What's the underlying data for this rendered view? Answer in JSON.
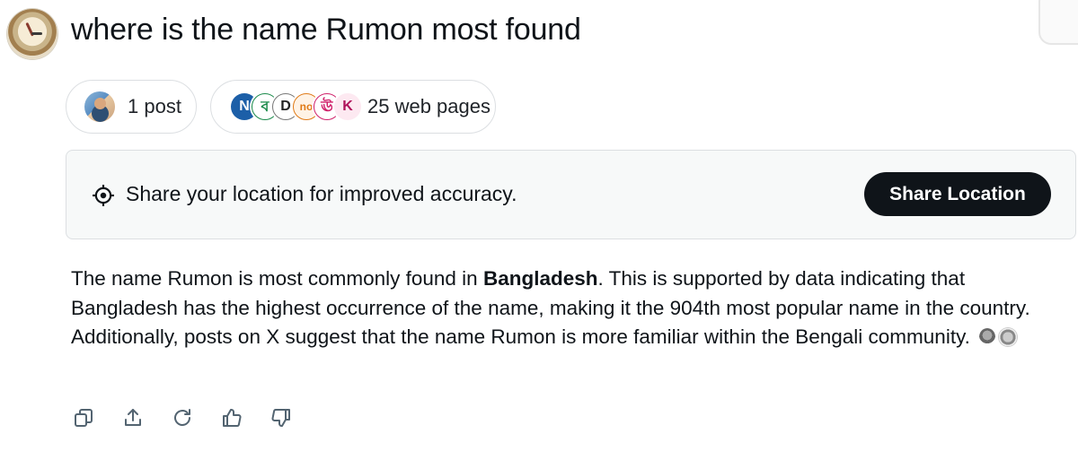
{
  "query": {
    "title": "where is the name Rumon most found"
  },
  "sources": {
    "posts_label": "1 post",
    "web_label": "25 web pages",
    "web_favicons": [
      "N",
      "ব",
      "D",
      "no",
      "ঊ",
      "K"
    ]
  },
  "location_banner": {
    "message": "Share your location for improved accuracy.",
    "button_label": "Share Location"
  },
  "answer": {
    "intro": "The name Rumon is most commonly found in ",
    "country": "Bangladesh",
    "rest": ". This is supported by data indicating that Bangladesh has the highest occurrence of the name, making it the 904th most popular name in the country. Additionally, posts on X suggest that the name Rumon is more familiar within the Bengali community."
  },
  "actions": {
    "icons": [
      "copy-icon",
      "share-icon",
      "regenerate-icon",
      "thumbs-up-icon",
      "thumbs-down-icon"
    ]
  },
  "colors": {
    "button_bg": "#0f1419",
    "banner_bg": "#f7f9f9",
    "border": "#dcdfe2"
  }
}
